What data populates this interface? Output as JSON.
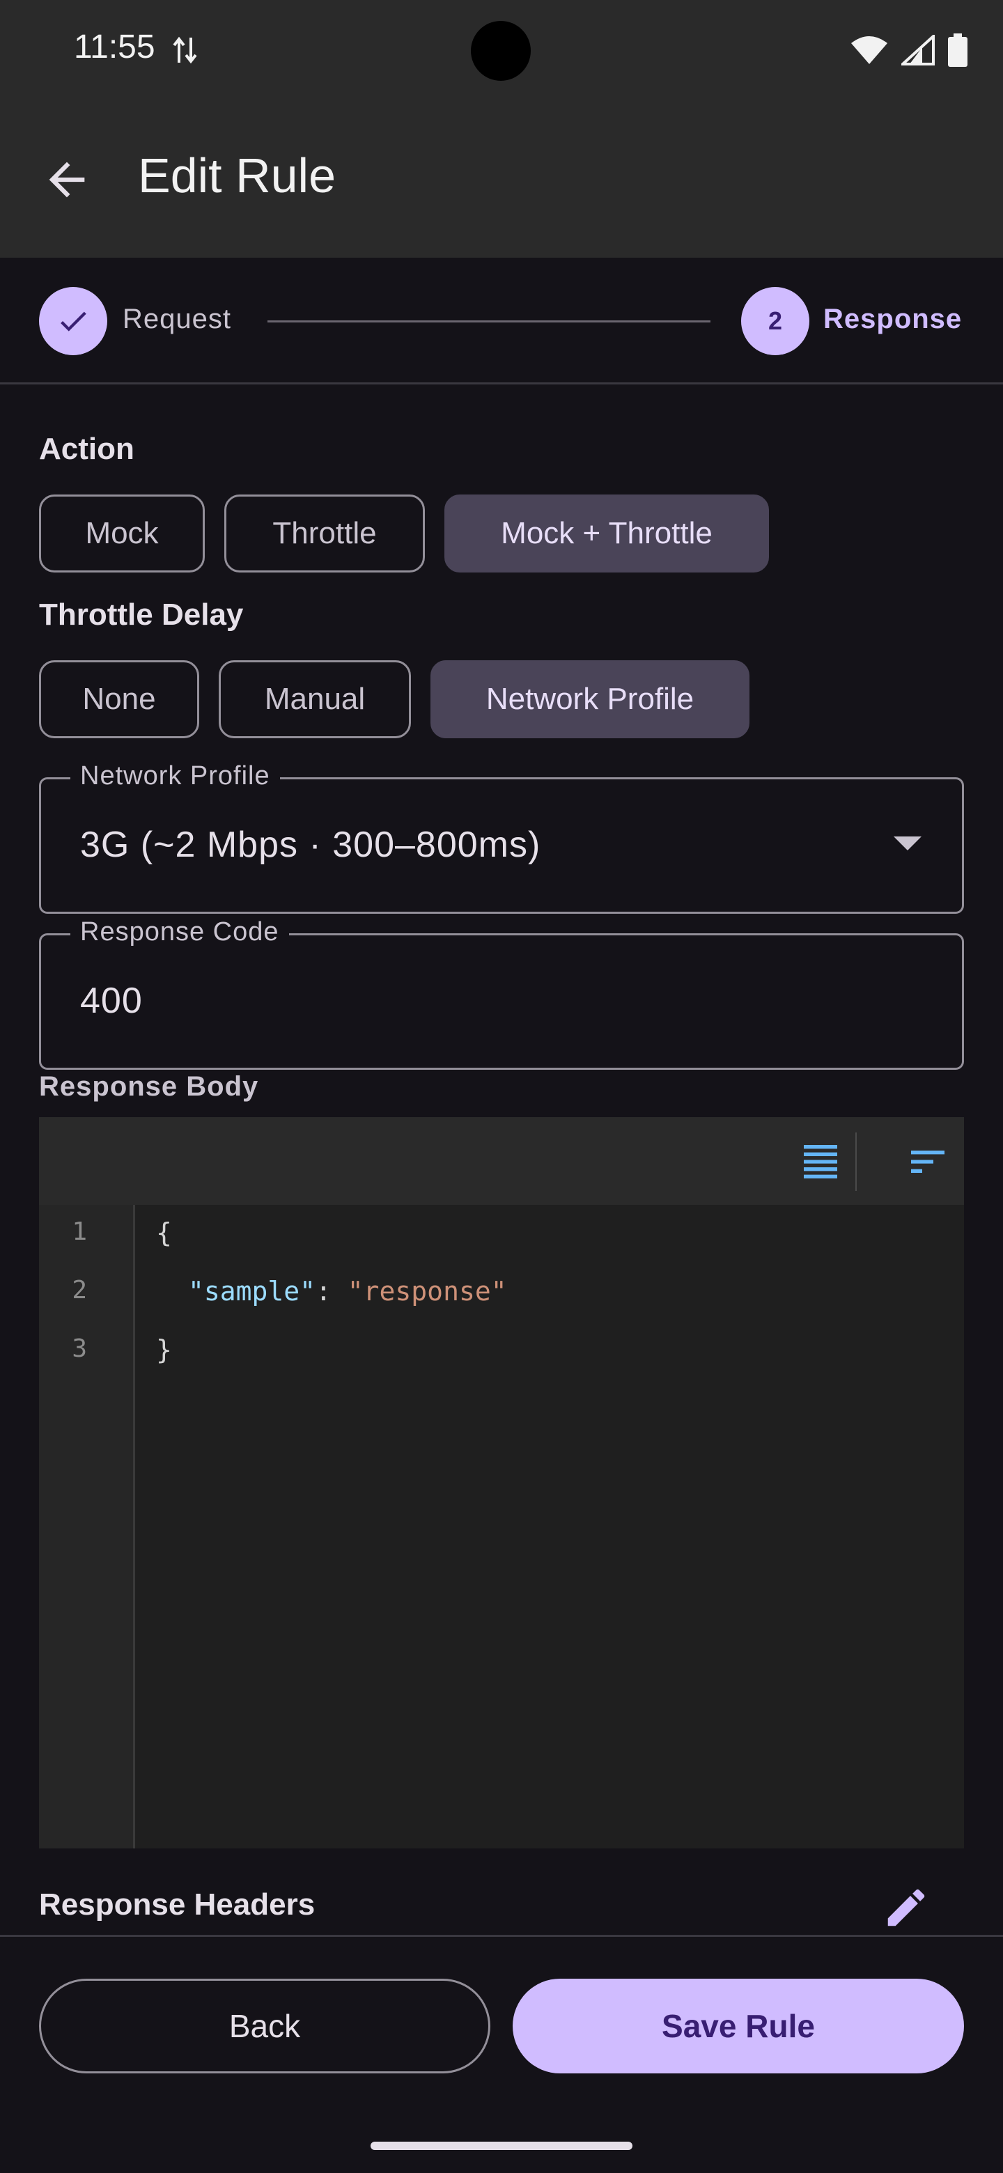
{
  "status_bar": {
    "time": "11:55",
    "icons": [
      "data-transfer-icon",
      "wifi-icon",
      "cellular-signal-icon",
      "battery-icon"
    ]
  },
  "app_bar": {
    "title": "Edit Rule",
    "back_icon": "arrow-back-icon"
  },
  "stepper": {
    "steps": [
      {
        "label": "Request",
        "state": "completed"
      },
      {
        "label": "Response",
        "number": "2",
        "state": "active"
      }
    ]
  },
  "action": {
    "label": "Action",
    "options": [
      "Mock",
      "Throttle",
      "Mock + Throttle"
    ],
    "selected": "Mock + Throttle"
  },
  "throttle_delay": {
    "label": "Throttle Delay",
    "options": [
      "None",
      "Manual",
      "Network Profile"
    ],
    "selected": "Network Profile"
  },
  "network_profile": {
    "label": "Network Profile",
    "value": "3G  (~2 Mbps · 300–800ms)"
  },
  "response_code": {
    "label": "Response Code",
    "value": "400"
  },
  "response_body": {
    "label": "Response Body",
    "line_numbers": [
      "1",
      "2",
      "3"
    ],
    "code": {
      "open": "{",
      "key": "\"sample\"",
      "colon": ": ",
      "value": "\"response\"",
      "close": "}"
    },
    "tools": [
      "wrap-lines-icon",
      "format-icon"
    ]
  },
  "response_headers": {
    "label": "Response Headers",
    "edit_icon": "edit-pencil-icon"
  },
  "actions": {
    "back_label": "Back",
    "save_label": "Save Rule"
  },
  "colors": {
    "background": "#141218",
    "app_bar": "#2A2A2A",
    "primary": "#D0BCFF",
    "on_primary": "#381E72",
    "selected_chip": "#4A4458",
    "outline": "#938F99",
    "code_key": "#9CDCFE",
    "code_string": "#CE9178"
  }
}
